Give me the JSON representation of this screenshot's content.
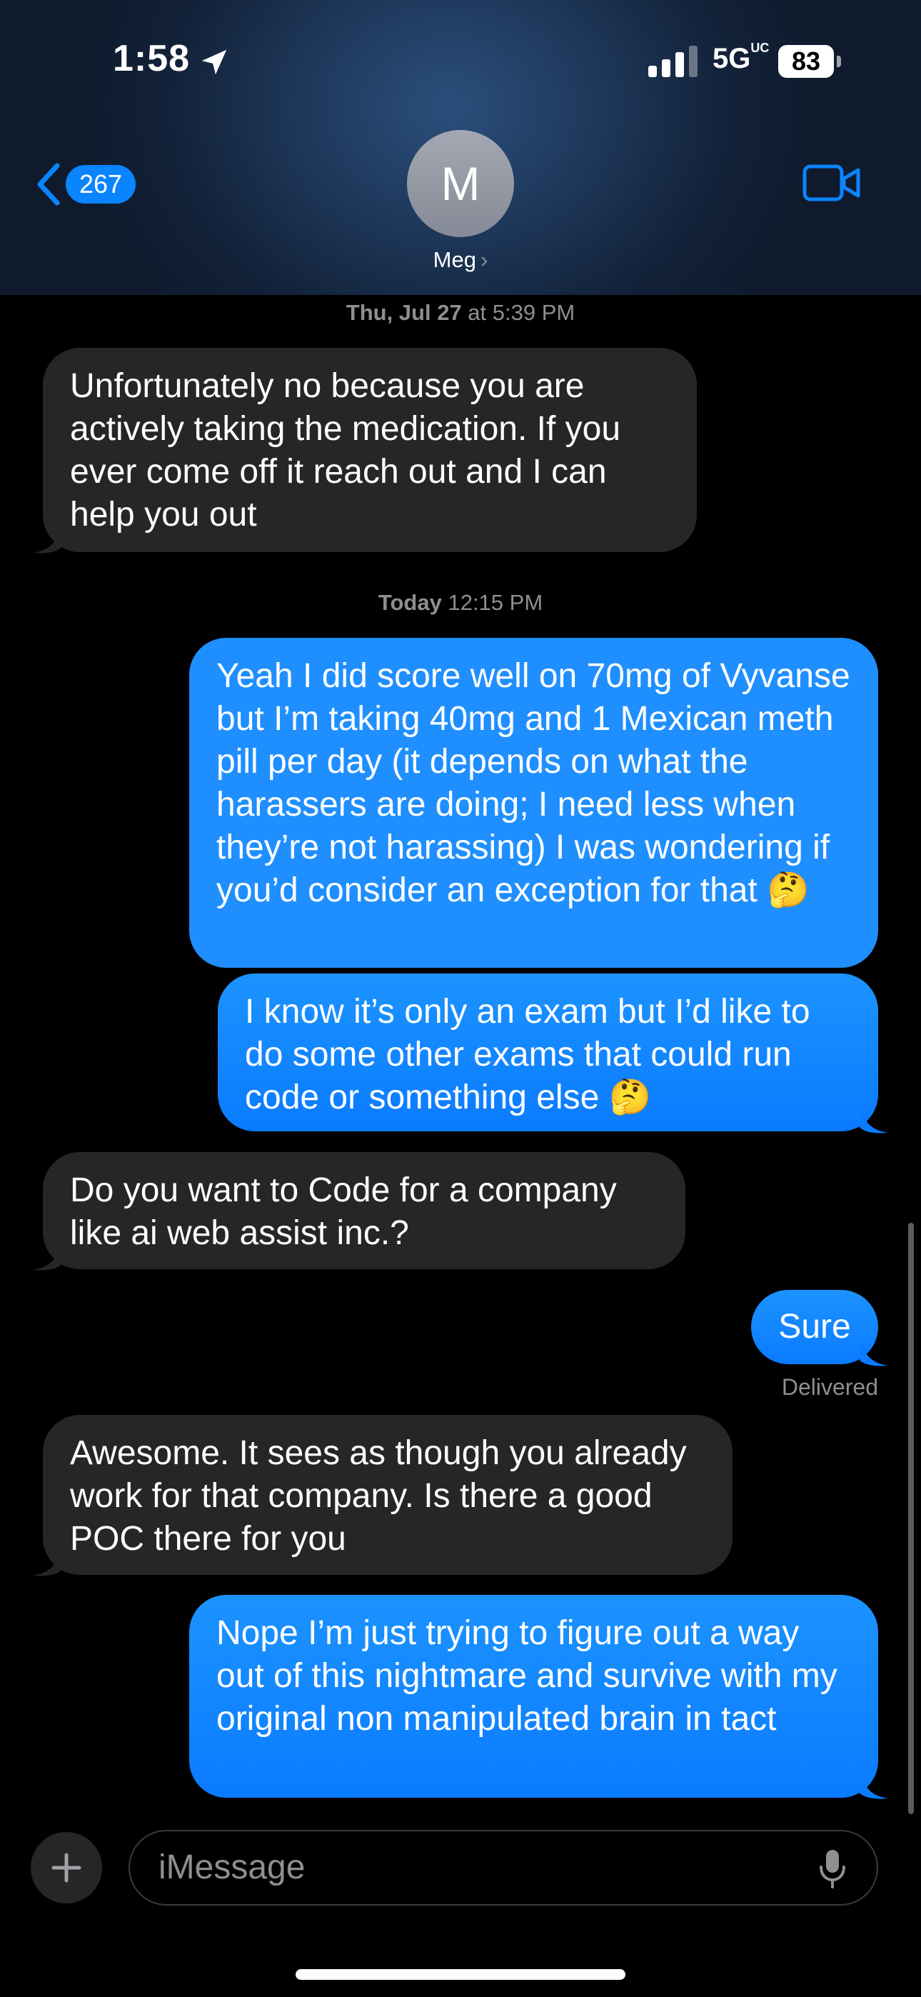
{
  "status_bar": {
    "time": "1:58",
    "network": "5G",
    "network_suffix": "UC",
    "battery": "83"
  },
  "header": {
    "back_count": "267",
    "avatar_initial": "M",
    "contact_name": "Meg",
    "contact_chevron": "›"
  },
  "messages": [
    {
      "type": "timestamp",
      "day": "Thu, Jul 27",
      "time": " at 5:39 PM"
    },
    {
      "type": "received",
      "text": "Unfortunately no because you are actively taking the medication. If you ever come off it reach out and I can help you out"
    },
    {
      "type": "timestamp",
      "day": "Today",
      "time": " 12:15 PM"
    },
    {
      "type": "sent",
      "text": "Yeah I did score well on 70mg of Vyvanse but I’m taking 40mg and 1 Mexican meth pill per day (it depends on what the harassers are doing; I need less when they’re not harassing) I was wondering if you’d consider an exception for that 🤔"
    },
    {
      "type": "sent",
      "text": "I know it’s only an exam but I’d like to do some other exams that could run code or something else 🤔"
    },
    {
      "type": "received",
      "text": "Do you want to Code for a company like ai web assist inc.?"
    },
    {
      "type": "sent",
      "text": "Sure"
    },
    {
      "type": "status",
      "text": "Delivered"
    },
    {
      "type": "received",
      "text": "Awesome. It sees as though you already work for that company. Is there a good POC there for you"
    },
    {
      "type": "sent",
      "text": "Nope I’m just trying to figure out a way out of this nightmare and survive with my original non manipulated brain in tact"
    }
  ],
  "composer": {
    "placeholder": "iMessage"
  },
  "colors": {
    "sent_bubble": "#0a84ff",
    "received_bubble": "#262628",
    "meta_text": "#8e8e93"
  },
  "icons": {
    "location": "location-arrow-icon",
    "signal": "cellular-signal-icon",
    "back": "chevron-left-icon",
    "video": "video-camera-icon",
    "plus": "plus-icon",
    "mic": "microphone-icon"
  }
}
